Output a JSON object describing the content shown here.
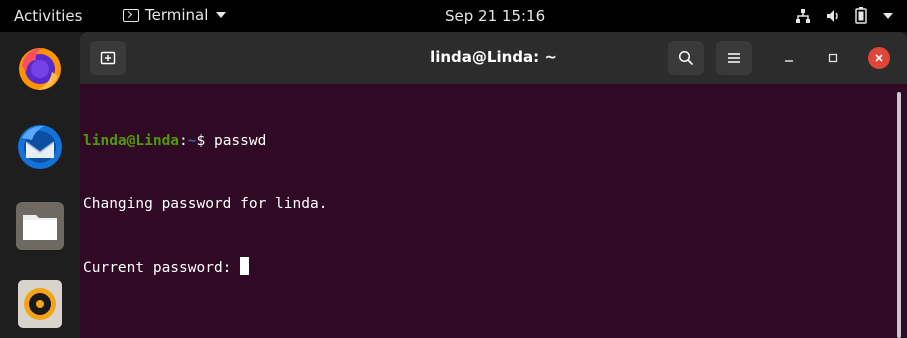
{
  "topbar": {
    "activities": "Activities",
    "app_name": "Terminal",
    "clock": "Sep 21  15:16"
  },
  "dock": {
    "items": [
      "firefox-icon",
      "thunderbird-icon",
      "files-icon",
      "rhythmbox-icon"
    ]
  },
  "window": {
    "title": "linda@Linda: ~",
    "prompt_user": "linda@Linda",
    "prompt_colon": ":",
    "prompt_path": "~",
    "prompt_symbol": "$ ",
    "command": "passwd",
    "output_line1": "Changing password for linda.",
    "output_line2": "Current password: "
  },
  "colors": {
    "terminal_bg": "#300a24",
    "prompt_user": "#4e9a06",
    "prompt_path": "#3465a4",
    "close_button": "#e0453a"
  }
}
